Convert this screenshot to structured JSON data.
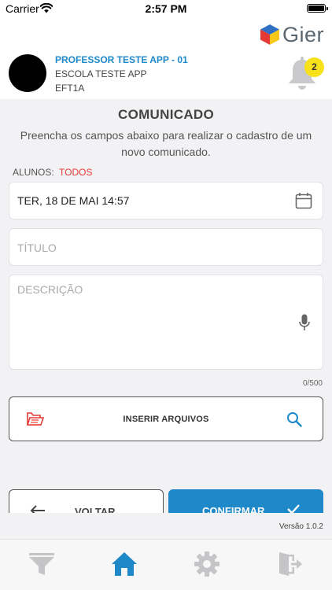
{
  "status_bar": {
    "carrier": "Carrier",
    "time": "2:57 PM",
    "battery_level": 1.0
  },
  "header": {
    "logo_text": "Gier",
    "professor": "PROFESSOR TESTE APP - 01",
    "school": "ESCOLA TESTE APP",
    "class_code": "EFT1A",
    "notification_count": "2"
  },
  "form": {
    "title": "COMUNICADO",
    "subtitle": "Preencha os campos abaixo para realizar o cadastro de um novo comunicado.",
    "alunos_label": "ALUNOS:",
    "alunos_value": "TODOS",
    "date_value": "TER, 18 DE MAI 14:57",
    "title_placeholder": "TÍTULO",
    "title_value": "",
    "description_placeholder": "DESCRIÇÃO",
    "description_value": "",
    "char_counter": "0/500",
    "attach_label": "INSERIR ARQUIVOS",
    "back_label": "VOLTAR",
    "confirm_label": "CONFIRMAR"
  },
  "footer": {
    "version": "Versão 1.0.2"
  },
  "tabs": [
    {
      "name": "filter-icon",
      "active": false
    },
    {
      "name": "home-icon",
      "active": true
    },
    {
      "name": "settings-icon",
      "active": false
    },
    {
      "name": "logout-icon",
      "active": false
    }
  ],
  "colors": {
    "accent": "#1e88c8",
    "alert_red": "#e53935",
    "badge_yellow": "#f7e11a",
    "inactive_icon": "#c5c5c8"
  }
}
